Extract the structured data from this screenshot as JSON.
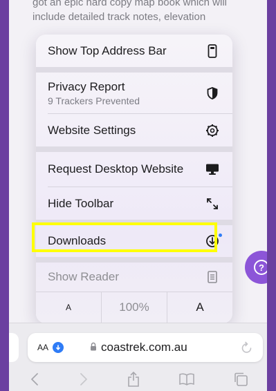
{
  "page": {
    "text_lines": [
      "got an epic hard copy map book which will",
      "include detailed track notes, elevation"
    ]
  },
  "menu": {
    "show_top_address_bar": "Show Top Address Bar",
    "privacy_report": "Privacy Report",
    "privacy_sub": "9 Trackers Prevented",
    "website_settings": "Website Settings",
    "request_desktop": "Request Desktop Website",
    "hide_toolbar": "Hide Toolbar",
    "downloads": "Downloads",
    "show_reader": "Show Reader",
    "font_small": "A",
    "zoom": "100%",
    "font_large": "A"
  },
  "address_bar": {
    "aa": "AA",
    "url": "coastrek.com.au"
  },
  "colors": {
    "highlight": "#ffff00",
    "help_button": "#8c55d8",
    "accent_blue": "#2f7cf6"
  },
  "icons": [
    "address-bar-icon",
    "shield-icon",
    "gear-icon",
    "desktop-icon",
    "expand-arrows-icon",
    "download-icon",
    "reader-icon",
    "question-icon",
    "lock-icon",
    "reload-icon",
    "back-icon",
    "forward-icon",
    "share-icon",
    "bookmarks-icon",
    "tabs-icon"
  ]
}
